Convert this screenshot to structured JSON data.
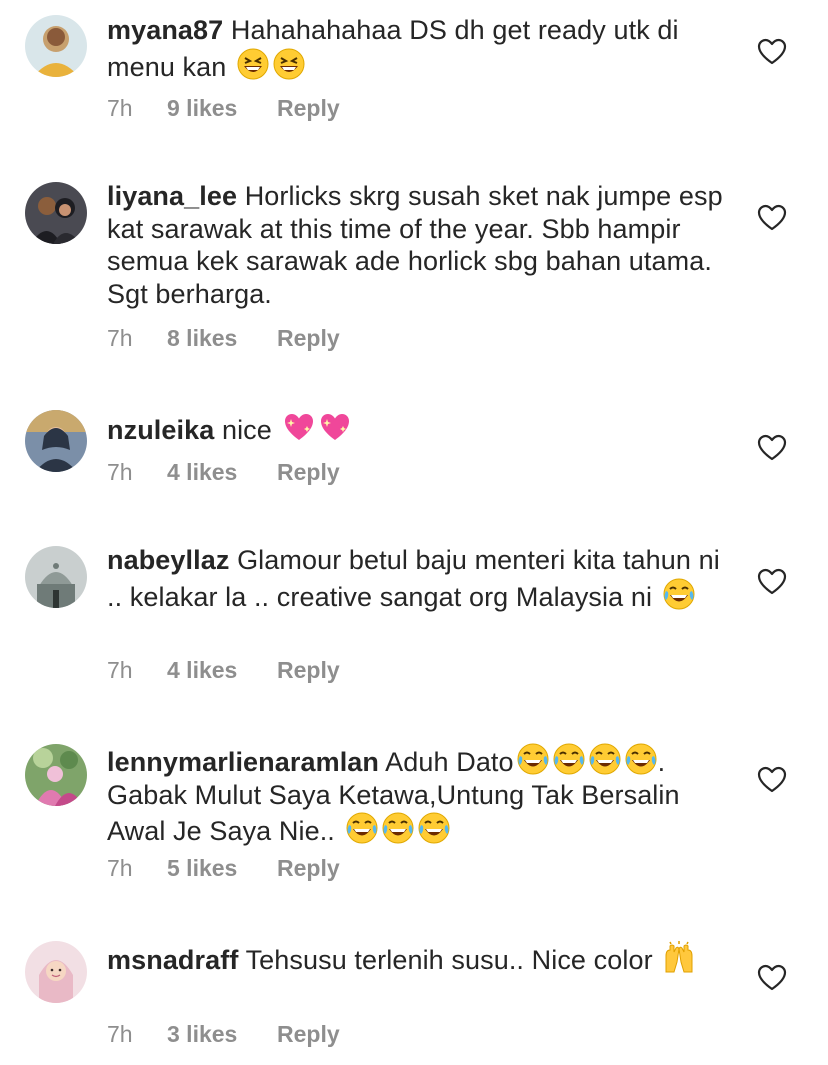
{
  "comments": [
    {
      "username": "myana87",
      "text": "Hahahahahaa DS dh get ready utk di menu kan",
      "emojis": [
        "grinning-squint-face",
        "grinning-squint-face"
      ],
      "time": "7h",
      "likes": "9 likes",
      "reply": "Reply",
      "avatar_colors": [
        "#d9e6ea",
        "#c7a06e"
      ]
    },
    {
      "username": "liyana_lee",
      "text": "Horlicks skrg susah sket nak jumpe esp kat sarawak at this time of the year. Sbb hampir semua kek sarawak ade horlick sbg bahan utama. Sgt berharga.",
      "emojis": [],
      "time": "7h",
      "likes": "8 likes",
      "reply": "Reply",
      "avatar_colors": [
        "#4a4a52",
        "#1d1d22"
      ]
    },
    {
      "username": "nzuleika",
      "text": "nice",
      "emojis": [
        "sparkling-heart",
        "sparkling-heart"
      ],
      "time": "7h",
      "likes": "4 likes",
      "reply": "Reply",
      "avatar_colors": [
        "#7b8fa8",
        "#2b3545"
      ]
    },
    {
      "username": "nabeyllaz",
      "text": "Glamour betul baju menteri kita tahun ni .. kelakar la .. creative sangat org Malaysia ni",
      "emojis": [
        "tears-of-joy"
      ],
      "time": "7h",
      "likes": "4 likes",
      "reply": "Reply",
      "avatar_colors": [
        "#c9cfcf",
        "#6f7b78"
      ]
    },
    {
      "username": "lennymarlienaramlan",
      "text": "Aduh Dato",
      "text_after": ". Gabak Mulut Saya Ketawa,Untung Tak Bersalin Awal Je Saya Nie..",
      "emojis_inline": [
        "tears-of-joy",
        "tears-of-joy",
        "tears-of-joy",
        "tears-of-joy"
      ],
      "emojis": [
        "tears-of-joy",
        "tears-of-joy",
        "tears-of-joy"
      ],
      "time": "7h",
      "likes": "5 likes",
      "reply": "Reply",
      "avatar_colors": [
        "#7fa46a",
        "#e07ab0"
      ]
    },
    {
      "username": "msnadraff",
      "text": "Tehsusu terlenih susu.. Nice color",
      "emojis": [
        "raising-hands"
      ],
      "time": "7h",
      "likes": "3 likes",
      "reply": "Reply",
      "avatar_colors": [
        "#f2dfe4",
        "#e9b9c6"
      ]
    }
  ],
  "icons": {
    "like": "heart-outline-icon"
  },
  "colors": {
    "text": "#262626",
    "meta": "#8e8e8e",
    "heart_stroke": "#262626"
  }
}
